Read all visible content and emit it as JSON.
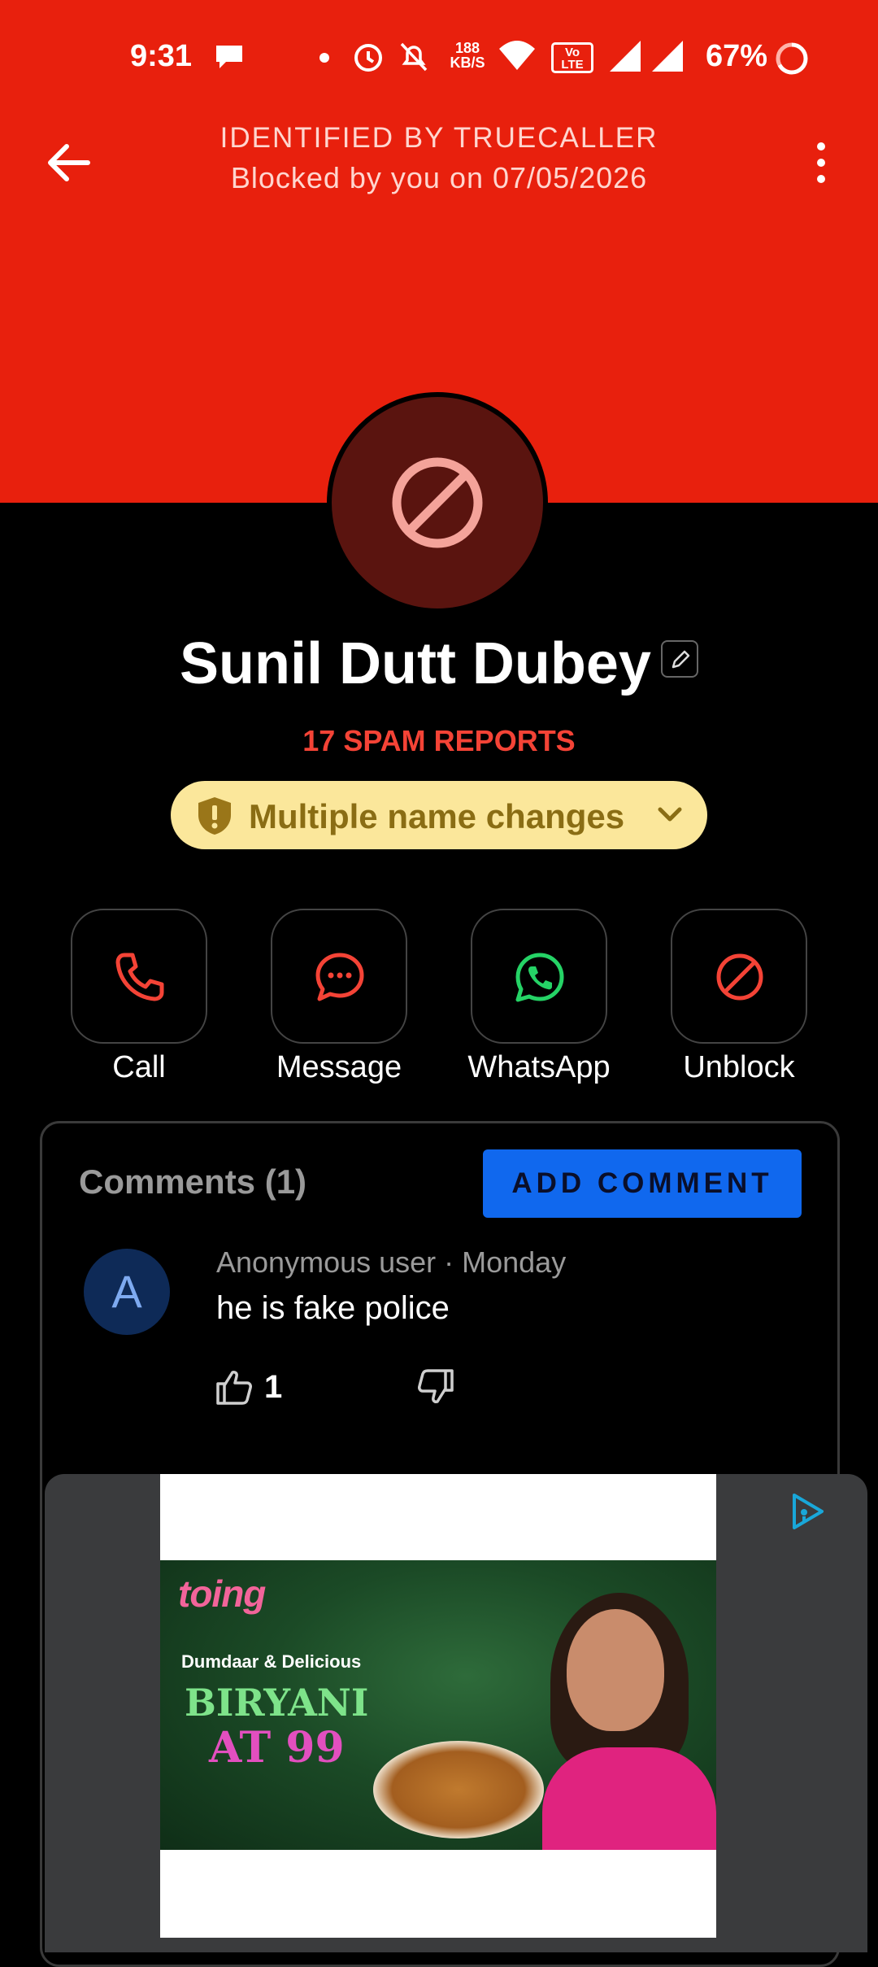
{
  "status_bar": {
    "time": "9:31",
    "net_speed_value": "188",
    "net_speed_unit": "KB/S",
    "volte": "Vo LTE",
    "battery": "67%"
  },
  "header": {
    "title": "IDENTIFIED BY TRUECALLER",
    "subtitle": "Blocked by you on 07/05/2026",
    "color": "#e8200d"
  },
  "contact": {
    "name": "Sunil Dutt Dubey",
    "spam_reports": "17 SPAM REPORTS",
    "warning": "Multiple name changes"
  },
  "actions": [
    {
      "label": "Call",
      "icon": "phone-icon"
    },
    {
      "label": "Message",
      "icon": "message-icon"
    },
    {
      "label": "WhatsApp",
      "icon": "whatsapp-icon"
    },
    {
      "label": "Unblock",
      "icon": "block-icon"
    }
  ],
  "comments": {
    "title": "Comments (1)",
    "add_button": "ADD COMMENT",
    "items": [
      {
        "avatar_letter": "A",
        "author_meta": "Anonymous user · Monday",
        "text": "he is fake police",
        "likes": "1"
      }
    ]
  },
  "ad": {
    "brand": "toing",
    "line1": "Dumdaar & Delicious",
    "line2": "BIRYANI",
    "line3": "AT 99"
  }
}
